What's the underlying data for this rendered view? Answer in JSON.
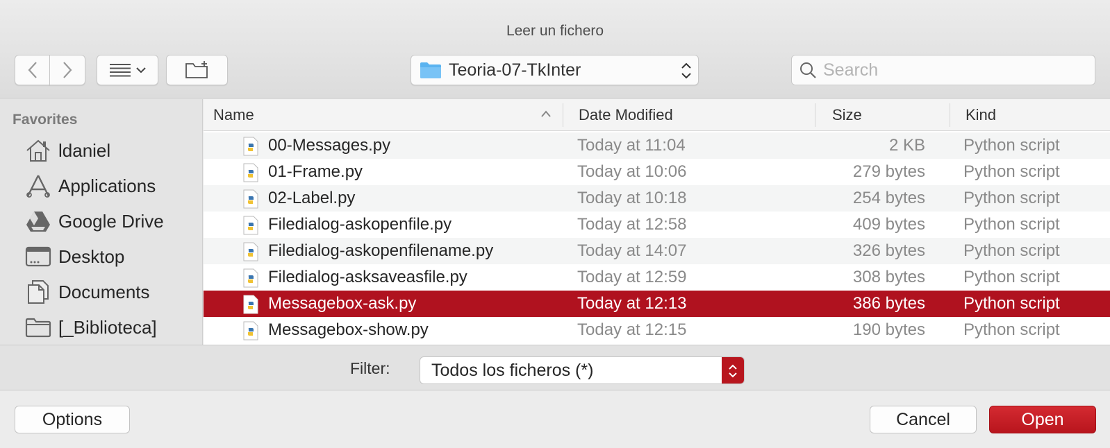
{
  "window": {
    "title": "Leer un fichero"
  },
  "toolbar": {
    "path_popup": {
      "label": "Teoria-07-TkInter",
      "icon": "folder-icon"
    },
    "search": {
      "placeholder": "Search",
      "value": ""
    }
  },
  "sidebar": {
    "heading": "Favorites",
    "items": [
      {
        "label": "ldaniel",
        "icon": "home-icon"
      },
      {
        "label": "Applications",
        "icon": "applications-icon"
      },
      {
        "label": "Google Drive",
        "icon": "google-drive-icon"
      },
      {
        "label": "Desktop",
        "icon": "desktop-icon"
      },
      {
        "label": "Documents",
        "icon": "documents-icon"
      },
      {
        "label": "[_Biblioteca]",
        "icon": "folder-icon"
      }
    ]
  },
  "filelist": {
    "columns": [
      "Name",
      "Date Modified",
      "Size",
      "Kind"
    ],
    "rows": [
      {
        "name": "00-Messages.py",
        "date": "Today at 11:04",
        "size": "2 KB",
        "kind": "Python script"
      },
      {
        "name": "01-Frame.py",
        "date": "Today at 10:06",
        "size": "279 bytes",
        "kind": "Python script"
      },
      {
        "name": "02-Label.py",
        "date": "Today at 10:18",
        "size": "254 bytes",
        "kind": "Python script"
      },
      {
        "name": "Filedialog-askopenfile.py",
        "date": "Today at 12:58",
        "size": "409 bytes",
        "kind": "Python script"
      },
      {
        "name": "Filedialog-askopenfilename.py",
        "date": "Today at 14:07",
        "size": "326 bytes",
        "kind": "Python script"
      },
      {
        "name": "Filedialog-asksaveasfile.py",
        "date": "Today at 12:59",
        "size": "308 bytes",
        "kind": "Python script"
      },
      {
        "name": "Messagebox-ask.py",
        "date": "Today at 12:13",
        "size": "386 bytes",
        "kind": "Python script"
      },
      {
        "name": "Messagebox-show.py",
        "date": "Today at 12:15",
        "size": "190 bytes",
        "kind": "Python script"
      }
    ],
    "selected_index": 6
  },
  "filter": {
    "label": "Filter:",
    "value": "Todos los ficheros (*)"
  },
  "buttons": {
    "options": "Options",
    "cancel": "Cancel",
    "open": "Open"
  },
  "colors": {
    "selection": "#b0121f",
    "accent": "#c41e25"
  }
}
